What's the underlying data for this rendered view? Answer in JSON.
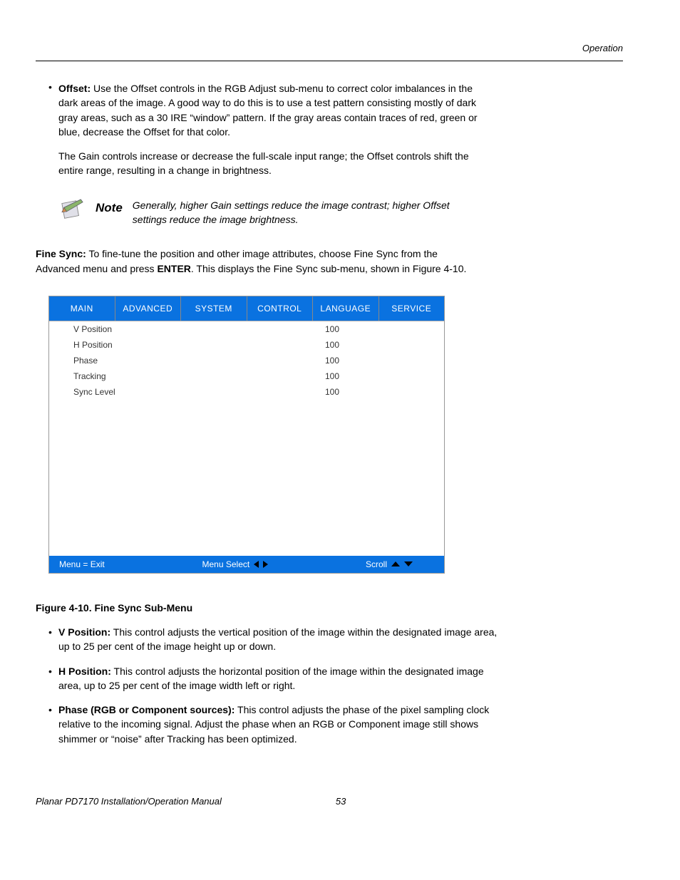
{
  "header": {
    "section": "Operation"
  },
  "offset": {
    "label": "Offset:",
    "body": "Use the Offset controls in the RGB Adjust sub-menu to correct color imbalances in the dark areas of the image. A good way to do this is to use a test pattern consisting mostly of dark gray areas, such as a 30 IRE “window” pattern. If the gray areas contain traces of red, green or blue, decrease the Offset for that color.",
    "followup": "The Gain controls increase or decrease the full-scale input range; the Offset controls shift the entire range, resulting in a change in brightness."
  },
  "note": {
    "label": "Note",
    "text": "Generally, higher Gain settings reduce the image contrast; higher Offset settings reduce the image brightness."
  },
  "fine_sync_intro": {
    "label": "Fine Sync:",
    "part1": "To fine-tune the position and other image attributes, choose Fine Sync from the Advanced menu and press ",
    "enter": "ENTER",
    "part2": ". This displays the Fine Sync sub-menu, shown in Figure 4-10."
  },
  "menu": {
    "tabs": [
      "MAIN",
      "ADVANCED",
      "SYSTEM",
      "CONTROL",
      "LANGUAGE",
      "SERVICE"
    ],
    "rows": [
      {
        "label": "V Position",
        "value": "100"
      },
      {
        "label": "H Position",
        "value": "100"
      },
      {
        "label": "Phase",
        "value": "100"
      },
      {
        "label": "Tracking",
        "value": "100"
      },
      {
        "label": "Sync Level",
        "value": "100"
      }
    ],
    "footer": {
      "exit": "Menu = Exit",
      "select": "Menu Select",
      "scroll": "Scroll"
    }
  },
  "figure_caption": "Figure 4-10. Fine Sync Sub-Menu",
  "defs": [
    {
      "label": "V Position:",
      "body": "This control adjusts the vertical position of the image within the designated image area, up to 25 per cent of the image height up or down."
    },
    {
      "label": "H Position:",
      "body": "This control adjusts the horizontal position of the image within the designated image area, up to 25 per cent of the image width left or right."
    },
    {
      "label": "Phase (RGB or Component sources):",
      "body": "This control adjusts the phase of the pixel sampling clock relative to the incoming signal. Adjust the phase when an RGB or Component image still shows shimmer or “noise” after Tracking has been optimized."
    }
  ],
  "footer": {
    "title": "Planar PD7170 Installation/Operation Manual",
    "page": "53"
  }
}
